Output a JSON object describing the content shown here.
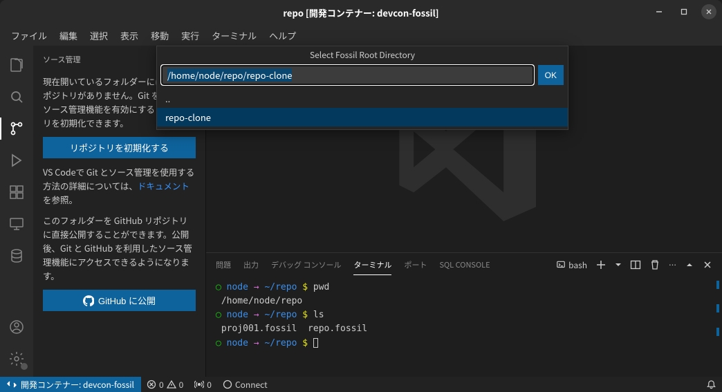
{
  "title": "repo [開発コンテナー: devcon-fossil]",
  "menubar": [
    "ファイル",
    "編集",
    "選択",
    "表示",
    "移動",
    "実行",
    "ターミナル",
    "ヘルプ"
  ],
  "sidebar": {
    "title": "ソース管理",
    "msg1": "現在開いているフォルダーには Git リポジトリがありません。Git を使用したソース管理機能を有効にするリポジトリを初期化できます。",
    "init_btn": "リポジトリを初期化する",
    "msg2a": "VS Codeで Git とソース管理を使用する方法の詳細については、",
    "msg2_link": "ドキュメント",
    "msg2b": "を参照。",
    "msg3": "このフォルダーを GitHub リポジトリに直接公開することができます。公開後、Git と GitHub を利用したソース管理機能にアクセスできるようになります。",
    "publish_btn": "GitHub に公開"
  },
  "picker": {
    "title": "Select Fossil Root Directory",
    "value": "/home/node/repo/repo-clone",
    "ok": "OK",
    "items": [
      "..",
      "repo-clone"
    ]
  },
  "panel": {
    "tabs": [
      "問題",
      "出力",
      "デバッグ コンソール",
      "ターミナル",
      "ポート",
      "SQL CONSOLE"
    ],
    "shell": "bash"
  },
  "terminal": {
    "l1_cmd": "pwd",
    "l2": " /home/node/repo",
    "l3_cmd": "ls",
    "l4": " proj001.fossil  repo.fossil",
    "prompt_node": "node",
    "prompt_arrow": "→",
    "prompt_path": "~/repo",
    "prompt_dollar": "$"
  },
  "status": {
    "remote": "開発コンテナー: devcon-fossil",
    "errors": "0",
    "warnings": "0",
    "ports": "0",
    "connect": "Connect"
  }
}
